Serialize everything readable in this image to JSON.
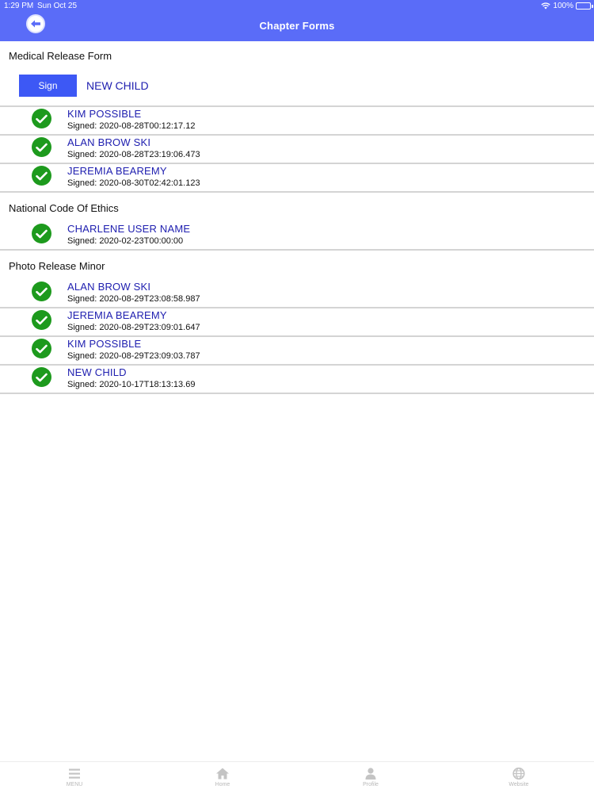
{
  "status_bar": {
    "time": "1:29 PM",
    "date": "Sun Oct 25",
    "battery": "100%"
  },
  "nav": {
    "title": "Chapter Forms"
  },
  "sections": [
    {
      "title": "Medical Release Form",
      "sign_label": "Sign",
      "child_selection": "NEW CHILD",
      "entries": [
        {
          "name": "KIM POSSIBLE",
          "signed": "Signed: 2020-08-28T00:12:17.12"
        },
        {
          "name": "ALAN BROW SKI",
          "signed": "Signed: 2020-08-28T23:19:06.473"
        },
        {
          "name": "JEREMIA BEAREMY",
          "signed": "Signed: 2020-08-30T02:42:01.123"
        }
      ]
    },
    {
      "title": "National Code Of Ethics",
      "entries": [
        {
          "name": "CHARLENE USER NAME",
          "signed": "Signed: 2020-02-23T00:00:00"
        }
      ]
    },
    {
      "title": "Photo Release Minor",
      "entries": [
        {
          "name": "ALAN BROW SKI",
          "signed": "Signed: 2020-08-29T23:08:58.987"
        },
        {
          "name": "JEREMIA BEAREMY",
          "signed": "Signed: 2020-08-29T23:09:01.647"
        },
        {
          "name": "KIM POSSIBLE",
          "signed": "Signed: 2020-08-29T23:09:03.787"
        },
        {
          "name": "NEW CHILD",
          "signed": "Signed: 2020-10-17T18:13:13.69"
        }
      ]
    }
  ],
  "tabs": [
    {
      "label": "MENU",
      "icon": "menu-icon"
    },
    {
      "label": "Home",
      "icon": "home-icon"
    },
    {
      "label": "Profile",
      "icon": "profile-icon"
    },
    {
      "label": "Website",
      "icon": "globe-icon"
    }
  ],
  "colors": {
    "header": "#5a6cf8",
    "sign_button": "#3d58f5",
    "link_text": "#2020b0",
    "check": "#1d9a1d"
  }
}
